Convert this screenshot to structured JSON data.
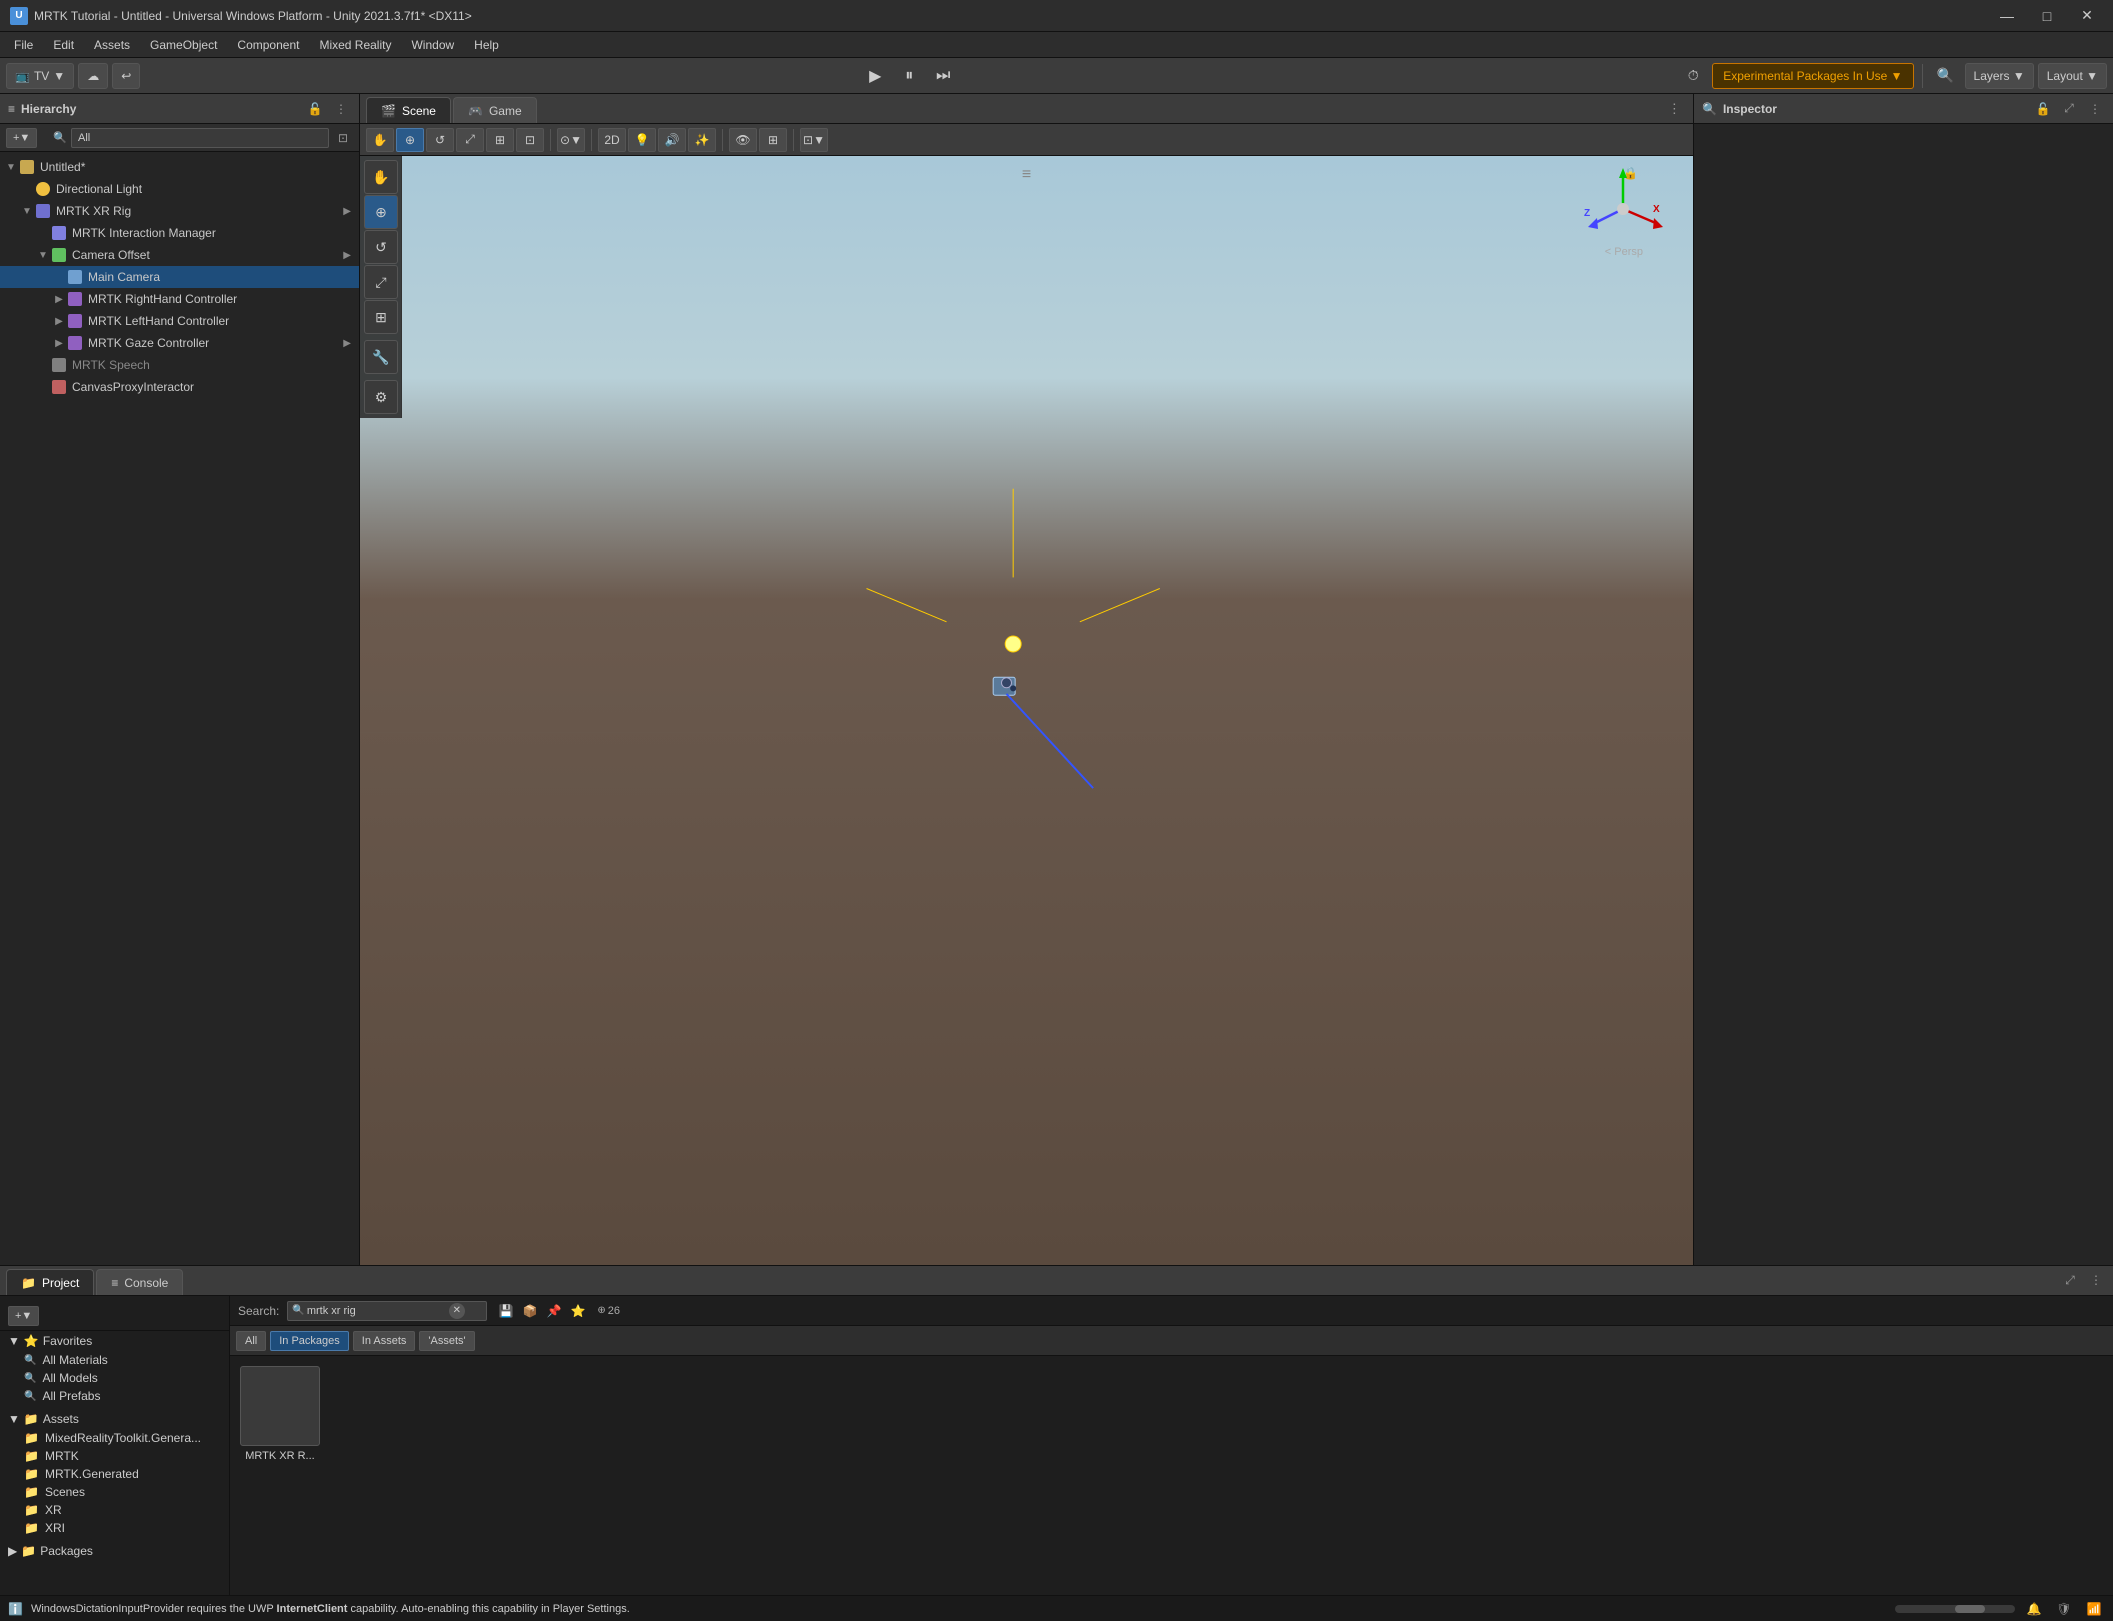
{
  "window": {
    "title": "MRTK Tutorial - Untitled - Universal Windows Platform - Unity 2021.3.7f1* <DX11>",
    "icon": "U"
  },
  "titlebar": {
    "minimize": "—",
    "maximize": "□",
    "close": "✕"
  },
  "menubar": {
    "items": [
      "File",
      "Edit",
      "Assets",
      "GameObject",
      "Component",
      "Mixed Reality",
      "Window",
      "Help"
    ]
  },
  "toolbar": {
    "tv_label": "TV",
    "cloud_icon": "☁",
    "back_icon": "↩",
    "play": "▶",
    "pause": "⏸",
    "step": "⏭",
    "experimental_label": "Experimental Packages In Use ▼",
    "search_icon": "🔍",
    "layers_label": "Layers ▼",
    "layout_label": "Layout ▼",
    "clock_icon": "🕐"
  },
  "hierarchy": {
    "title": "Hierarchy",
    "search_placeholder": "All",
    "items": [
      {
        "label": "Untitled*",
        "level": 0,
        "icon": "scene",
        "expanded": true
      },
      {
        "label": "Directional Light",
        "level": 1,
        "icon": "light",
        "expanded": false
      },
      {
        "label": "MRTK XR Rig",
        "level": 1,
        "icon": "rig",
        "expanded": true
      },
      {
        "label": "MRTK Interaction Manager",
        "level": 2,
        "icon": "manager",
        "expanded": false
      },
      {
        "label": "Camera Offset",
        "level": 2,
        "icon": "offset",
        "expanded": true
      },
      {
        "label": "Main Camera",
        "level": 3,
        "icon": "camera",
        "expanded": false
      },
      {
        "label": "MRTK RightHand Controller",
        "level": 3,
        "icon": "controller",
        "expanded": false
      },
      {
        "label": "MRTK LeftHand Controller",
        "level": 3,
        "icon": "controller",
        "expanded": false
      },
      {
        "label": "MRTK Gaze Controller",
        "level": 3,
        "icon": "controller",
        "expanded": false
      },
      {
        "label": "MRTK Speech",
        "level": 2,
        "icon": "generic",
        "expanded": false,
        "gray": true
      },
      {
        "label": "CanvasProxyInteractor",
        "level": 2,
        "icon": "canvas",
        "expanded": false
      }
    ]
  },
  "scene_tabs": [
    {
      "label": "Scene",
      "icon": "🎬",
      "active": true
    },
    {
      "label": "Game",
      "icon": "🎮",
      "active": false
    }
  ],
  "scene_tools": [
    {
      "label": "↔",
      "title": "Pan",
      "active": false
    },
    {
      "label": "⊕",
      "title": "Move",
      "active": true
    },
    {
      "label": "↺",
      "title": "Rotate",
      "active": false
    },
    {
      "label": "⤢",
      "title": "Scale",
      "active": false
    },
    {
      "label": "⬜",
      "title": "Rect",
      "active": false
    }
  ],
  "inspector": {
    "title": "Inspector"
  },
  "bottom": {
    "tabs": [
      {
        "label": "Project",
        "icon": "📁",
        "active": true
      },
      {
        "label": "Console",
        "icon": "≡",
        "active": false
      }
    ],
    "search_placeholder": "mrtk xr rig",
    "filters": [
      "All",
      "In Packages",
      "In Assets",
      "'Assets'"
    ],
    "active_filter": "In Packages",
    "search_label": "Search:",
    "count": "26",
    "sidebar": {
      "favorites": {
        "label": "Favorites",
        "items": [
          "All Materials",
          "All Models",
          "All Prefabs"
        ]
      },
      "assets": {
        "label": "Assets",
        "items": [
          "MixedRealityToolkit.Genera...",
          "MRTK",
          "MRTK.Generated",
          "Scenes",
          "XR",
          "XRI"
        ]
      },
      "packages": {
        "label": "Packages"
      }
    },
    "asset_items": [
      {
        "label": "MRTK XR R..."
      }
    ]
  },
  "status_bar": {
    "icon": "ℹ",
    "text_prefix": "WindowsDictationInputProvider",
    "text_middle": " requires the UWP ",
    "text_bold": "InternetClient",
    "text_suffix": " capability. Auto-enabling this capability in Player Settings."
  },
  "gizmo": {
    "persp_label": "< Persp"
  }
}
